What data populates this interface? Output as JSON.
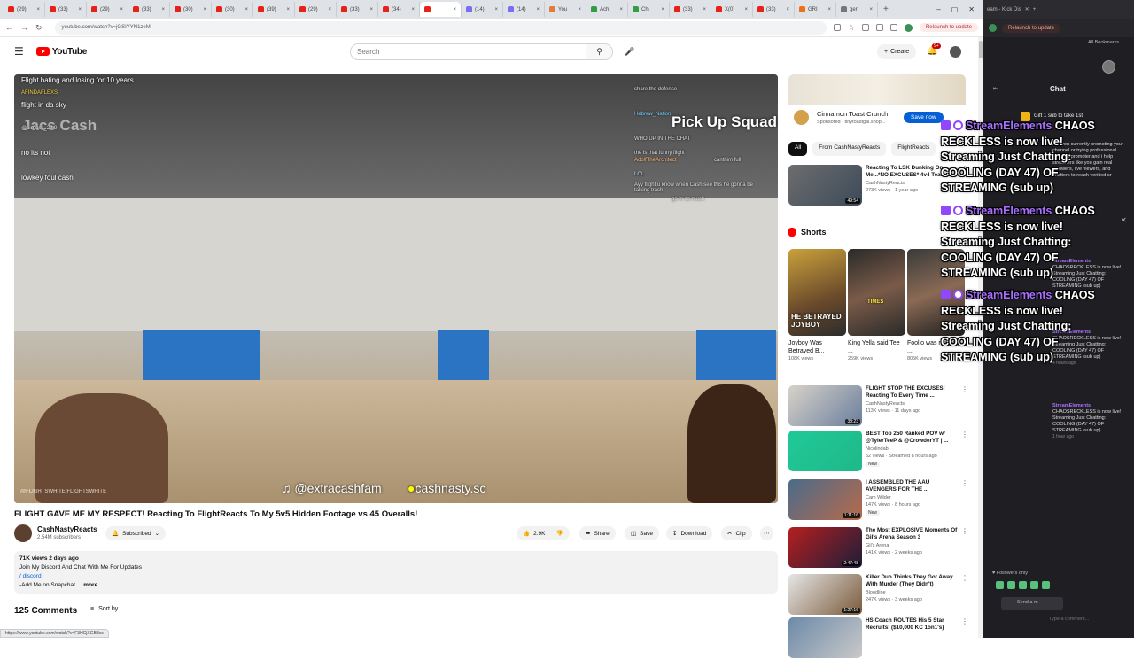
{
  "browser": {
    "tabs": [
      "(29)",
      "(33)",
      "(29)",
      "(33)",
      "(30)",
      "(30)",
      "(39)",
      "(29)",
      "(33)",
      "(34)",
      "",
      "(14)",
      "(14)",
      "You",
      "Ach",
      "Chi",
      "(33)",
      "X(0)",
      "(33)",
      "GRI",
      "gen"
    ],
    "url": "youtube.com/watch?v=jGSIYYN1zeM",
    "relaunch": "Relaunch to update",
    "status_url": "https://www.youtube.com/watch?v=F3HCjXGB8xc"
  },
  "youtube": {
    "logo": "YouTube",
    "search_placeholder": "Search",
    "create": "Create",
    "notif_count": "9+"
  },
  "player": {
    "overlay_title": "Flight hating and losing for 10 years",
    "chat_lines": [
      {
        "user": "AFINDAFLEXS",
        "text": "flight in da sky"
      },
      {
        "user": "",
        "text": "no its not"
      },
      {
        "user": "",
        "text": "lowkey foul cash"
      }
    ],
    "mute_users": [
      "@airness_23 9"
    ],
    "overlay_big": "Jacs Cash",
    "pickup": "Pick Up Squad",
    "handle_tiktok": "@extracashfam",
    "handle_snap": "cashnasty.sc",
    "watermark": "@FLIGHTSWHITE  FLIGHTSWHITE",
    "chat_right": [
      "share the defense",
      "Hebrew_Nation",
      "WHO UP IN THE CHAT",
      "the is that funny flight",
      "AdolfTheArchitect",
      "canthim full",
      "LOL",
      "Ayy flight u know when Cash see this he gonna be talking trash",
      "go in so much"
    ]
  },
  "video": {
    "title": "FLIGHT GAVE ME MY RESPECT! Reacting To FlightReacts To My 5v5 Hidden Footage vs 45 Overalls!",
    "channel": "CashNastyReacts",
    "subscribers": "2.54M subscribers",
    "subscribed_label": "Subscribed",
    "likes": "2.9K",
    "share": "Share",
    "save": "Save",
    "download": "Download",
    "clip": "Clip",
    "views_age": "71K views  2 days ago",
    "desc_line1": "Join My Discord And Chat With Me For Updates",
    "desc_line2": "/ discord",
    "desc_line3": "-Add Me on Snapchat",
    "more": "...more",
    "comments": "125 Comments",
    "sort": "Sort by"
  },
  "ad": {
    "title": "Cinnamon Toast Crunch",
    "sponsored": "Sponsored · tinytoastgal.shop...",
    "button": "Save now"
  },
  "chips": [
    "All",
    "From CashNastyReacts",
    "FlightReacts"
  ],
  "recs": [
    {
      "title": "Reacting To LSK Dunking On Me...*NO EXCUSES* 4v4 Team...",
      "channel": "CashNastyReacts",
      "views": "273K views · 1 year ago",
      "dur": "49:54",
      "new": ""
    },
    {
      "title": "FLIGHT STOP THE EXCUSES! Reacting To Every Time ...",
      "channel": "CashNastyReacts",
      "views": "113K views · 11 days ago",
      "dur": "38:23",
      "new": ""
    },
    {
      "title": "BEST Top 250 Ranked POV w/ @TylerTeeP & @CrowderYT | ...",
      "channel": "Nicolindab",
      "views": "52 views · Streamed 8 hours ago",
      "dur": "",
      "new": "New"
    },
    {
      "title": "I ASSEMBLED THE AAU AVENGERS FOR THE ...",
      "channel": "Cam Wilder",
      "views": "147K views · 8 hours ago",
      "dur": "1:11:16",
      "new": "New"
    },
    {
      "title": "The Most EXPLOSIVE Moments Of Gil's Arena Season 3",
      "channel": "Gil's Arena",
      "views": "141K views · 2 weeks ago",
      "dur": "2:47:48",
      "new": ""
    },
    {
      "title": "Killer Duo Thinks They Got Away With Murder (They Didn't)",
      "channel": "Bloodline",
      "views": "247K views · 3 weeks ago",
      "dur": "1:27:16",
      "new": ""
    },
    {
      "title": "HS Coach ROUTES His 5 Star Recruits! ($10,000 KC 1on1's)",
      "channel": "",
      "views": "",
      "dur": "",
      "new": ""
    }
  ],
  "shorts": {
    "header": "Shorts",
    "items": [
      {
        "title": "Joyboy Was Betrayed B...",
        "views": "108K views",
        "thumb_text": "HE BETRAYED JOYBOY"
      },
      {
        "title": "King Yella said Tee ...",
        "views": "259K views",
        "thumb_text": "TIMES"
      },
      {
        "title": "Foolio was ready to ...",
        "views": "805K views",
        "thumb_text": ""
      }
    ]
  },
  "side": {
    "tab_title": "eam - Kick Dis",
    "bookmarks": "All Bookmarks",
    "chat": "Chat",
    "pinned": "Gift 1 sub to take 1st",
    "promo": "Are you currently promoting your channel or trying professional channel promoter and i help streamers like you gain real followers, live viewers, and chatters to reach verified or",
    "msg": "CHAOSRECKLESS is now live! Streaming Just Chatting: COOLING (DAY 47) OF STREAMING (sub up)",
    "who": "StreamElements",
    "ts": "4 hours ago",
    "ts2": "1 hour ago",
    "followers": "Followers only",
    "send": "Send a m",
    "send2": "Type a comment..."
  },
  "se_overlay": {
    "source": "StreamElements",
    "text": "CHAOS RECKLESS is now live! Streaming Just Chatting: COOLING (DAY 47) OF STREAMING (sub up)"
  }
}
